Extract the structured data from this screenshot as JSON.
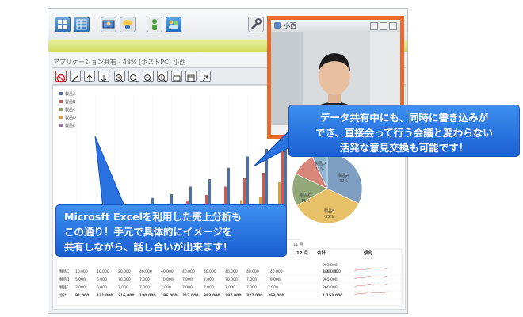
{
  "window": {
    "title": "アプリケーション共有 - 48% [ホストPC] 小西"
  },
  "video_panel": {
    "title": "小西"
  },
  "callouts": {
    "top_right": {
      "line1": "データ共有中にも、同時に書き込みが",
      "line2": "でき、直接会って行う会議と変わらない",
      "line3": "活発な意見交換も可能です！"
    },
    "bottom_left": {
      "line1": "Microsft Excelを利用した売上分析も",
      "line2": "この通り！手元で具体的にイメージを",
      "line3": "共有しながら、話し合いが出来ます！"
    }
  },
  "sheet": {
    "legend": [
      "製品A",
      "製品B",
      "製品C",
      "製品D",
      "製品E"
    ],
    "xaxis_label": "11 月",
    "header_month": "12 月",
    "header_total": "合計",
    "header_trend": "傾向",
    "row_labels": [
      "製品C",
      "製品D",
      "製品F",
      "合計"
    ],
    "rows": [
      [
        "10,000",
        "10,000",
        "20,000",
        "40,000",
        "40,000",
        "40,000",
        "40,000",
        "40,000",
        "40,000",
        "140,000",
        "1,000,000"
      ],
      [
        "5,000",
        "6,000",
        "70,000",
        "7,000",
        "70,000",
        "7,000",
        "7,000",
        "70,000",
        "7,000",
        "70,000",
        "965,000"
      ],
      [
        "3,000",
        "5,000",
        "7,000",
        "7,000",
        "7,000",
        "7,000",
        "7,000",
        "7,000",
        "7,000",
        "7,000",
        "360,000"
      ],
      [
        "91,000",
        "111,000",
        "216,000",
        "180,000",
        "196,000",
        "212,000",
        "363,000",
        "397,000",
        "327,000",
        "363,000",
        "1,153,000"
      ]
    ],
    "extra_totals": [
      "903,000",
      "360,000"
    ],
    "pie_labels": [
      {
        "name": "製品A",
        "pct": "32%"
      },
      {
        "name": "製品B",
        "pct": "35%"
      },
      {
        "name": "製品C",
        "pct": "15%"
      },
      {
        "name": "製品D",
        "pct": "11%"
      }
    ]
  },
  "colors": {
    "frame_orange": "#e86a2e",
    "callout_blue": "#2a72e0",
    "strip_yellow": "#d9e070"
  }
}
